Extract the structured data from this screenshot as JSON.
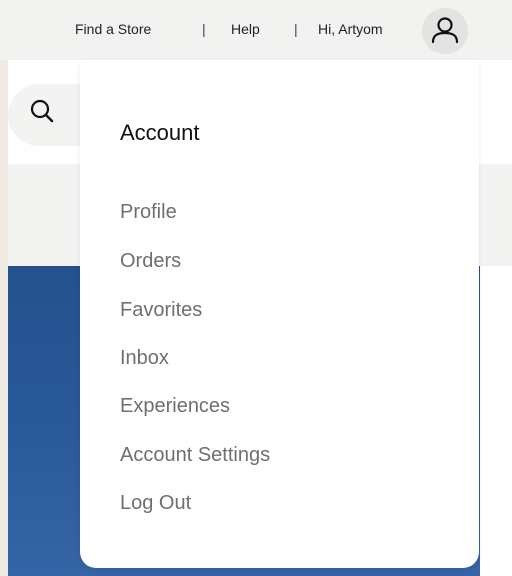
{
  "utility_bar": {
    "find_store": "Find a Store",
    "separator": "|",
    "help": "Help",
    "greeting": "Hi, Artyom",
    "account_icon": "user-icon"
  },
  "search": {
    "icon": "search-icon"
  },
  "account_menu": {
    "title": "Account",
    "items": [
      {
        "label": "Profile"
      },
      {
        "label": "Orders"
      },
      {
        "label": "Favorites"
      },
      {
        "label": "Inbox"
      },
      {
        "label": "Experiences"
      },
      {
        "label": "Account Settings"
      },
      {
        "label": "Log Out"
      }
    ]
  },
  "colors": {
    "background": "#efebe3",
    "hero_blue": "#2a5a9a",
    "menu_text": "#6f6f6f"
  }
}
